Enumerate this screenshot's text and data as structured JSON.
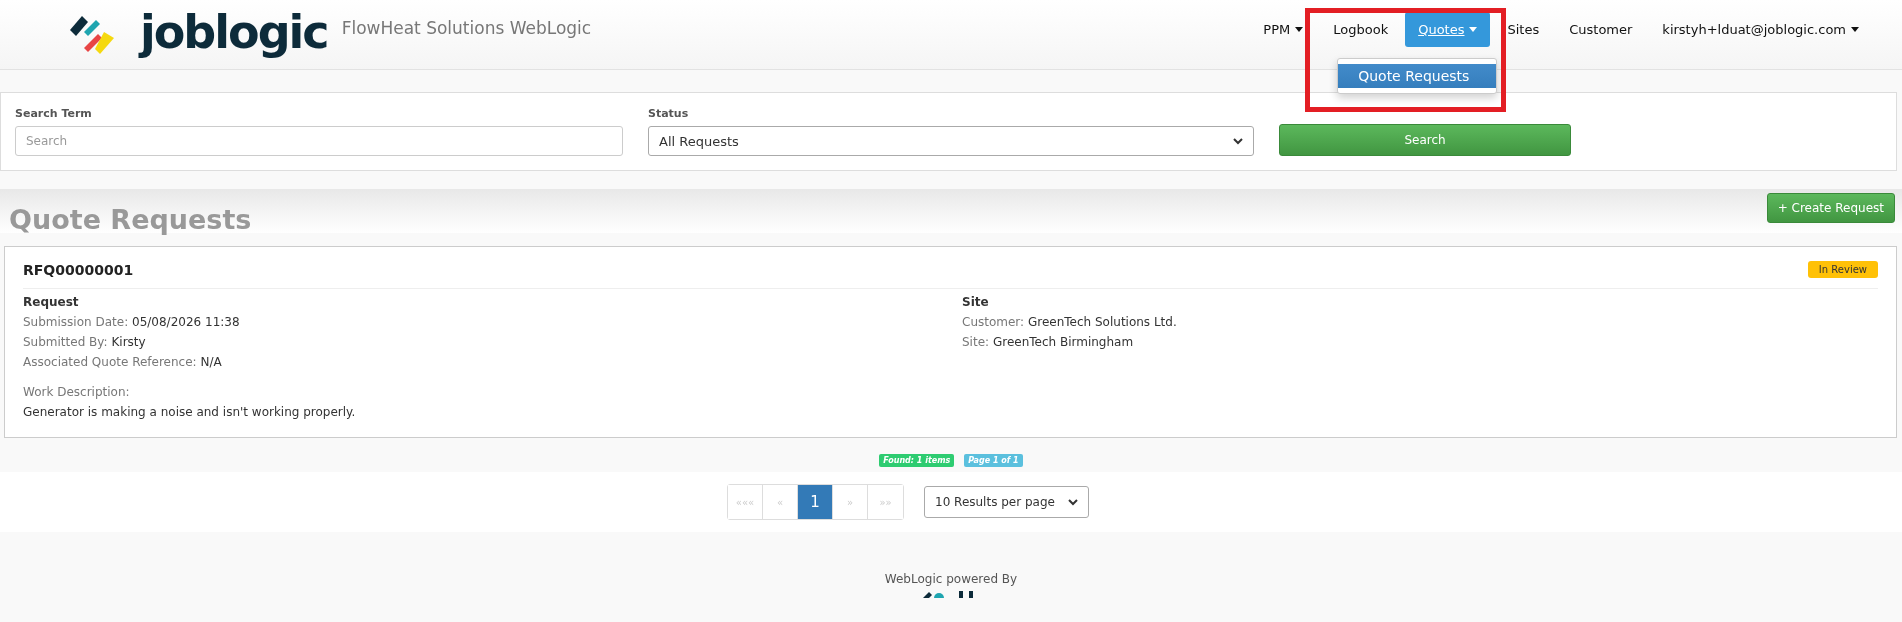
{
  "header": {
    "logo_text": "joblogic",
    "app_title": "FlowHeat Solutions WebLogic",
    "nav": [
      {
        "label": "PPM",
        "kind": "dropdown",
        "selected": false
      },
      {
        "label": "Logbook",
        "kind": "link",
        "selected": false
      },
      {
        "label": "Quotes",
        "kind": "dropdown",
        "selected": true,
        "menu": [
          {
            "label": "Quote Requests",
            "selected": true
          }
        ]
      },
      {
        "label": "Sites",
        "kind": "link",
        "selected": false
      },
      {
        "label": "Customer",
        "kind": "link",
        "selected": false
      },
      {
        "label": "kirstyh+lduat@joblogic.com",
        "kind": "dropdown",
        "selected": false
      }
    ]
  },
  "search": {
    "term_label": "Search Term",
    "term_placeholder": "Search",
    "status_label": "Status",
    "status_value": "All Requests",
    "button": "Search"
  },
  "page": {
    "title": "Quote Requests",
    "create_button": "+ Create Request"
  },
  "requests": [
    {
      "id": "RFQ00000001",
      "status": "In Review",
      "color": "#ffc107",
      "request_heading": "Request",
      "request_fields": [
        {
          "label": "Submission Date:",
          "value": "05/08/2026 11:38"
        },
        {
          "label": "Submitted By:",
          "value": "Kirsty"
        },
        {
          "label": "Associated Quote Reference:",
          "value": "N/A"
        }
      ],
      "work_label": "Work Description:",
      "work_text": "Generator is making a noise and isn't working properly.",
      "site_heading": "Site",
      "site_fields": [
        {
          "label": "Customer:",
          "value": "GreenTech Solutions Ltd."
        },
        {
          "label": "Site:",
          "value": "GreenTech Birmingham"
        }
      ]
    }
  ],
  "summary": {
    "found": "Found: 1 items",
    "page": "Page 1 of 1"
  },
  "pagination": [
    {
      "label": "«««",
      "selected": false,
      "disabled": true
    },
    {
      "label": "«",
      "selected": false,
      "disabled": true
    },
    {
      "label": "1",
      "selected": true,
      "disabled": false
    },
    {
      "label": "»",
      "selected": false,
      "disabled": true
    },
    {
      "label": "»»",
      "selected": false,
      "disabled": true
    }
  ],
  "per_page": "10 Results per page",
  "footer": {
    "text": "WebLogic powered By"
  }
}
